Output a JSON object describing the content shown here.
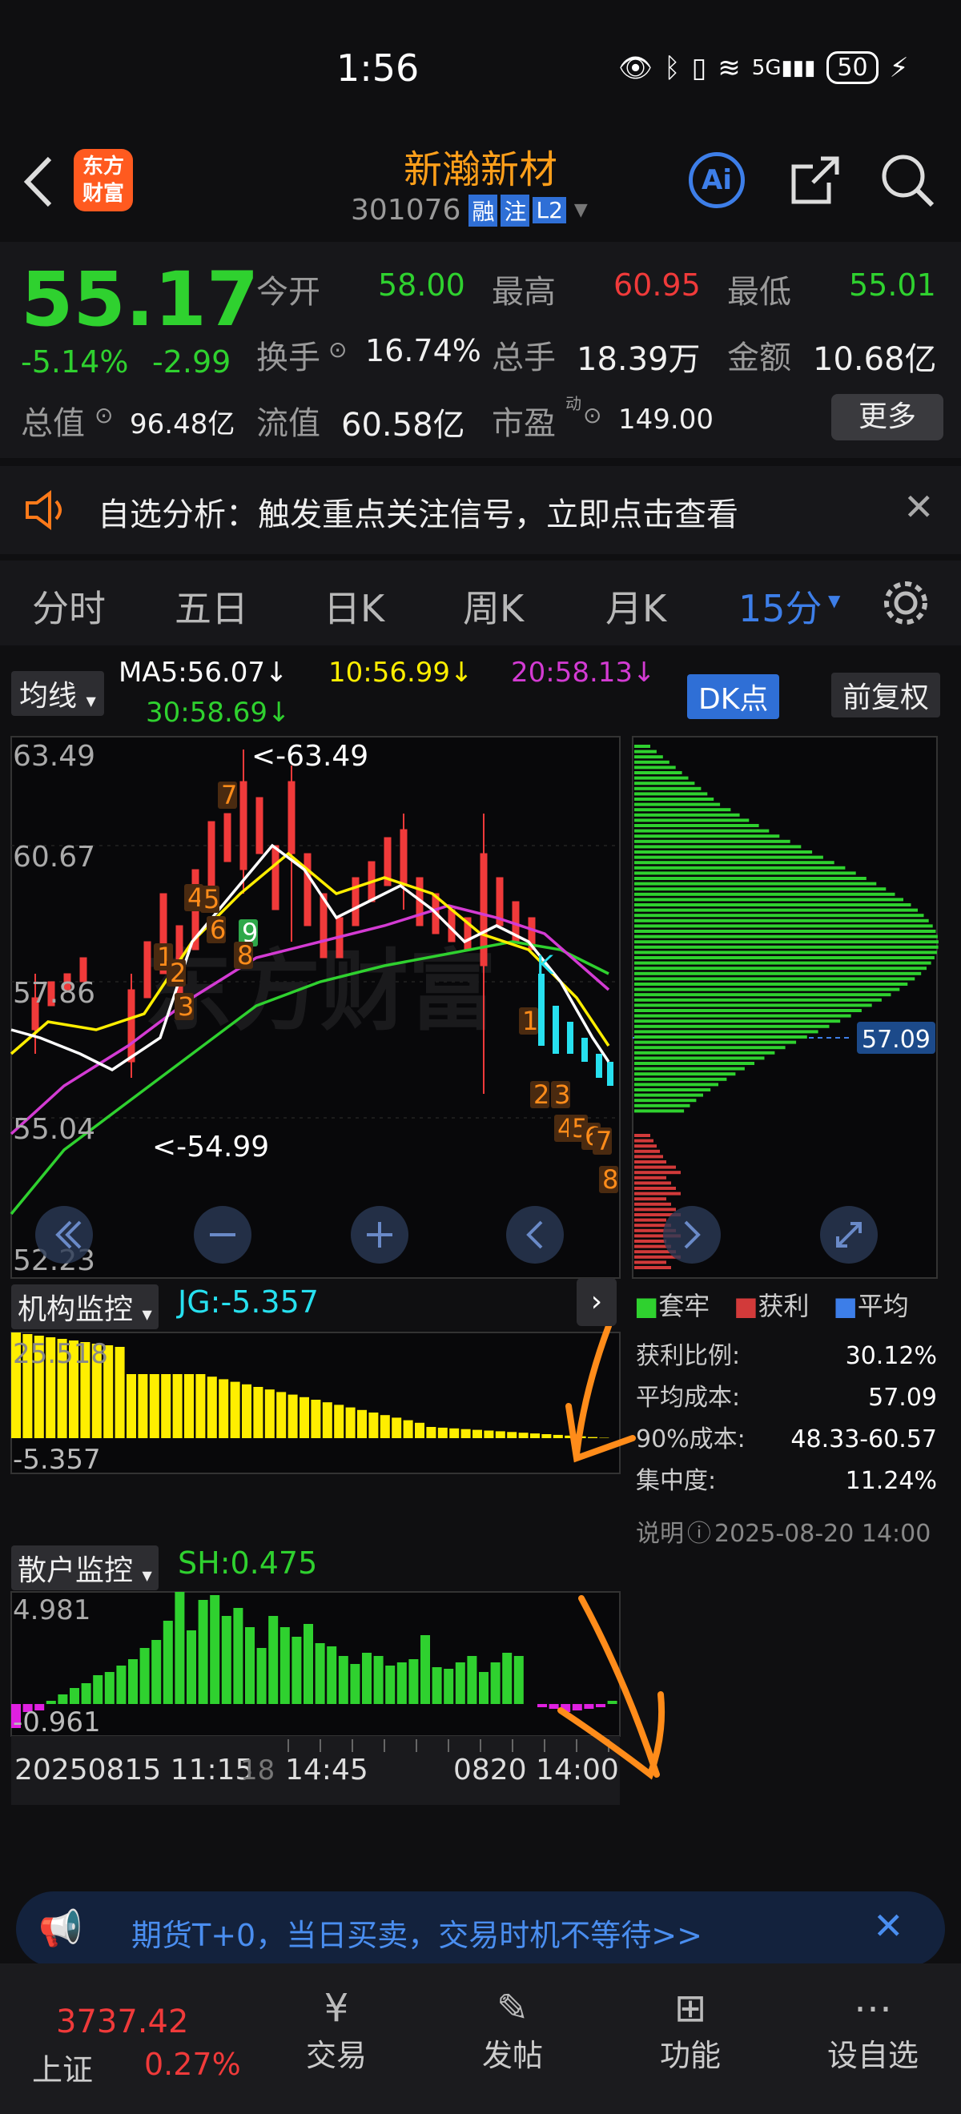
{
  "status": {
    "time": "1:56",
    "battery": "50"
  },
  "header": {
    "title": "新瀚新材",
    "code": "301076",
    "tag1": "融",
    "tag2": "注",
    "tag3": "L2",
    "brand1": "东方",
    "brand2": "财富",
    "ai": "Ai"
  },
  "quote": {
    "price": "55.17",
    "pct": "-5.14%",
    "chg": "-2.99",
    "open_label": "今开",
    "open": "58.00",
    "high_label": "最高",
    "high": "60.95",
    "low_label": "最低",
    "low": "55.01",
    "turnover_label": "换手",
    "turnover": "16.74%",
    "volume_label": "总手",
    "volume": "18.39万",
    "amount_label": "金额",
    "amount": "10.68亿",
    "mktcap_label": "总值",
    "mktcap": "96.48亿",
    "float_label": "流值",
    "float": "60.58亿",
    "pe_label": "市盈",
    "pe_sup": "动",
    "pe": "149.00",
    "more": "更多"
  },
  "notice": {
    "text": "自选分析：触发重点关注信号，立即点击查看"
  },
  "tabs": [
    "分时",
    "五日",
    "日K",
    "周K",
    "月K",
    "15分"
  ],
  "ma": {
    "label": "均线",
    "ma5": "MA5:56.07↓",
    "ma10": "10:56.99↓",
    "ma20": "20:58.13↓",
    "ma30": "30:58.69↓",
    "dk": "DK点",
    "fq": "前复权"
  },
  "chart_labels": {
    "y1": "63.49",
    "y2": "60.67",
    "y3": "57.86",
    "y4": "55.04",
    "y5": "52.23",
    "high_mark": "<-63.49",
    "low_mark": "<-54.99",
    "cost": "57.09",
    "k": "K",
    "nums": [
      "7",
      "4",
      "5",
      "6",
      "9",
      "8",
      "1",
      "2",
      "3",
      "1",
      "2",
      "3",
      "4",
      "5",
      "6",
      "7",
      "8"
    ]
  },
  "chip": {
    "legend": [
      "套牢",
      "获利",
      "平均"
    ],
    "profit_label": "获利比例:",
    "profit": "30.12%",
    "avg_label": "平均成本:",
    "avg": "57.09",
    "c90_label": "90%成本:",
    "c90": "48.33-60.57",
    "conc_label": "集中度:",
    "conc": "11.24%",
    "note": "说明",
    "date": "2025-08-20 14:00"
  },
  "jg": {
    "label": "机构监控",
    "value": "JG:-5.357",
    "top": "25.518",
    "bottom": "-5.357"
  },
  "sh": {
    "label": "散户监控",
    "value": "SH:0.475",
    "top": "4.981",
    "bottom": "-0.961"
  },
  "axis": {
    "left": "20250815 11:15",
    "left2": "18",
    "mid": "14:45",
    "right": "0820 14:00"
  },
  "banner": {
    "text": "期货T+0，当日买卖，交易时机不等待>>"
  },
  "bottom": {
    "index_val": "3737.42",
    "index_name": "上证",
    "index_pct": "0.27%",
    "items": [
      "交易",
      "发帖",
      "功能",
      "设自选"
    ]
  },
  "colors": {
    "up": "#f03a3a",
    "down": "#2fd12f",
    "accent": "#3d7ee8",
    "cyan": "#27e0ef",
    "yellow": "#ffee00",
    "orange": "#ff8c1a"
  }
}
